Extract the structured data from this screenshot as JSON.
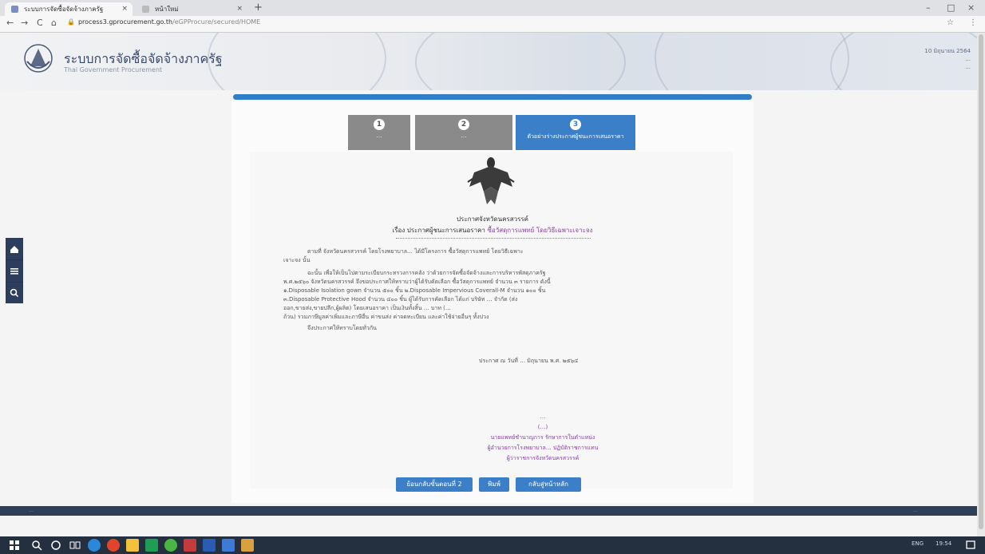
{
  "browser": {
    "tabs": [
      {
        "label": "ระบบการจัดซื้อจัดจ้างภาครัฐ"
      },
      {
        "label": "หน้าใหม่"
      }
    ],
    "new_tab": "+",
    "url_host": "process3.gprocurement.go.th",
    "url_path": "/eGPProcure/secured/HOME",
    "controls": {
      "back": "←",
      "forward": "→",
      "reload": "C",
      "home": "⌂",
      "star": "☆",
      "profile": "⋮",
      "minimize": "–",
      "maximize": "□",
      "close": "×"
    }
  },
  "header": {
    "title": "ระบบการจัดซื้อจัดจ้างภาครัฐ",
    "subtitle": "Thai Government Procurement",
    "date": "10 มิถุนายน 2564",
    "user_line": "…",
    "org_line": "…"
  },
  "stepper": {
    "steps": [
      {
        "number": "1",
        "label": "…",
        "active": false
      },
      {
        "number": "2",
        "label": "…",
        "active": false
      },
      {
        "number": "3",
        "label": "ตัวอย่างร่างประกาศผู้ชนะการเสนอราคา",
        "active": true
      }
    ]
  },
  "document": {
    "title": "ประกาศจังหวัดนครสวรรค์",
    "subject_prefix": "เรื่อง ประกาศผู้ชนะการเสนอราคา",
    "subject_item": "ซื้อวัสดุการแพทย์ โดยวิธีเฉพาะเจาะจง",
    "paragraph1": [
      "ตามที่ จังหวัดนครสวรรค์ โดยโรงพยาบาล… ได้มีโครงการ ซื้อวัสดุการแพทย์ โดยวิธีเฉพาะ",
      "เจาะจง นั้น"
    ],
    "paragraph2": [
      "ฉะนั้น เพื่อให้เป็นไปตามระเบียบกระทรวงการคลัง ว่าด้วยการจัดซื้อจัดจ้างและการบริหารพัสดุภาครัฐ",
      "พ.ศ.๒๕๖๐ จังหวัดนครสวรรค์ จึงขอประกาศให้ทราบว่าผู้ได้รับคัดเลือก ซื้อวัสดุการแพทย์ จำนวน ๓ รายการ ดังนี้",
      "๑.Disposable Isolation gown จำนวน ๕๐๐ ชิ้น ๒.Disposable Impervious Coverall-M จำนวน ๑๐๐ ชิ้น",
      "๓.Disposable Protective Hood จำนวน ๔๐๐ ชิ้น ผู้ได้รับการคัดเลือก ได้แก่ บริษัท … จำกัด (ส่ง",
      "ออก,ขายส่ง,ขายปลีก,ผู้ผลิต) โดยเสนอราคา เป็นเงินทั้งสิ้น … บาท (…",
      "ถ้วน) รวมภาษีมูลค่าเพิ่มและภาษีอื่น ค่าขนส่ง ค่าจดทะเบียน และค่าใช้จ่ายอื่นๆ ทั้งปวง"
    ],
    "closing": "จึงประกาศให้ทราบโดยทั่วกัน",
    "announce_date": "ประกาศ ณ วันที่ … มิถุนายน พ.ศ. ๒๕๖๔",
    "signature": [
      "…",
      "(…)",
      "นายแพทย์ชำนาญการ รักษาการในตำแหน่ง",
      "ผู้อำนวยการโรงพยาบาล… ปฏิบัติราชการแทน",
      "ผู้ว่าราชการจังหวัดนครสวรรค์"
    ]
  },
  "buttons": {
    "back": "ย้อนกลับขั้นตอนที่ 2",
    "print": "พิมพ์",
    "home": "กลับสู่หน้าหลัก"
  },
  "footer": {
    "left": "…",
    "right": "…"
  },
  "taskbar": {
    "tray_lang": "ENG",
    "clock": "19:54"
  },
  "colors": {
    "accent": "#3a7fc8",
    "sidebar": "#2d3e5c",
    "highlight": "#8a3ea8",
    "step_inactive": "#8a8a8a"
  }
}
